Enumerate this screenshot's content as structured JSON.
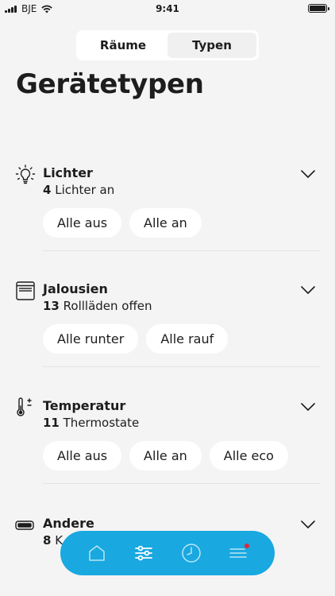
{
  "status_bar": {
    "carrier": "BJE",
    "time": "9:41"
  },
  "segmented": {
    "rooms": "Räume",
    "types": "Typen",
    "active": "types"
  },
  "page": {
    "title": "Gerätetypen"
  },
  "sections": [
    {
      "title": "Lichter",
      "count": "4",
      "sub": " Lichter an",
      "icon": "bulb-icon",
      "actions": [
        "Alle aus",
        "Alle an"
      ]
    },
    {
      "title": "Jalousien",
      "count": "13",
      "sub": " Rollläden offen",
      "icon": "blinds-icon",
      "actions": [
        "Alle runter",
        "Alle rauf"
      ]
    },
    {
      "title": "Temperatur",
      "count": "11",
      "sub": " Thermostate",
      "icon": "thermometer-icon",
      "actions": [
        "Alle aus",
        "Alle an",
        "Alle eco"
      ]
    },
    {
      "title": "Andere",
      "count": "8",
      "sub": " K",
      "icon": "socket-icon",
      "actions": []
    }
  ],
  "nav": {
    "items": [
      "home-icon",
      "sliders-icon",
      "clock-icon",
      "menu-icon"
    ],
    "active": "sliders-icon",
    "accent": "#19a8e0",
    "badge_color": "#e3263b"
  }
}
